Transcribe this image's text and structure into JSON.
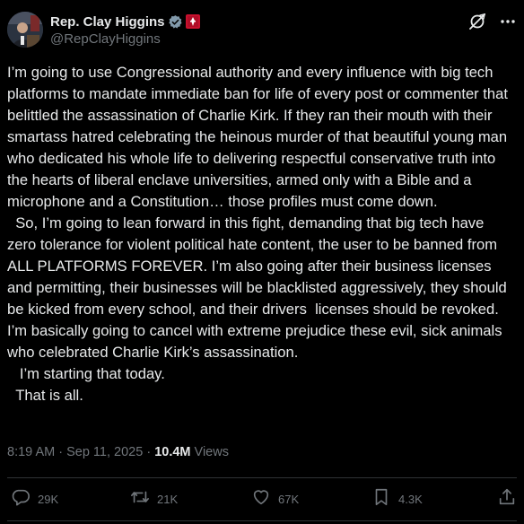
{
  "author": {
    "display_name": "Rep. Clay Higgins",
    "handle": "@RepClayHiggins",
    "verified_icon": "verified-badge-icon",
    "affiliation_icon": "flag-badge-icon"
  },
  "header_actions": [
    "grok-icon",
    "more-icon"
  ],
  "body": {
    "paragraphs": [
      "I’m going to use Congressional authority and every influence with big tech platforms to mandate immediate ban for life of every post or commenter that belittled the assassination of Charlie Kirk. If they ran their mouth with their smartass hatred celebrating the heinous murder of that beautiful young man who dedicated his whole life to delivering respectful conservative truth into the hearts of liberal enclave universities, armed only with a Bible and a microphone and a Constitution… those profiles must come down.",
      "  So, I’m going to lean forward in this fight, demanding that big tech have zero tolerance for violent political hate content, the user to be banned from ALL PLATFORMS FOREVER. I’m also going after their business licenses and permitting, their businesses will be blacklisted aggressively, they should be kicked from every school, and their drivers  licenses should be revoked. I’m basically going to cancel with extreme prejudice these evil, sick animals who celebrated Charlie Kirk’s assassination.",
      "   I’m starting that today.",
      "  That is all."
    ]
  },
  "meta": {
    "time": "8:19 AM",
    "separator": " · ",
    "date": "Sep 11, 2025",
    "views_count": "10.4M",
    "views_label": " Views"
  },
  "actions": {
    "replies": "29K",
    "reposts": "21K",
    "likes": "67K",
    "bookmarks": "4.3K"
  },
  "colors": {
    "background": "#000000",
    "text": "#e7e9ea",
    "secondary": "#71767b",
    "verified": "#829aab",
    "divider": "#2f3336"
  }
}
